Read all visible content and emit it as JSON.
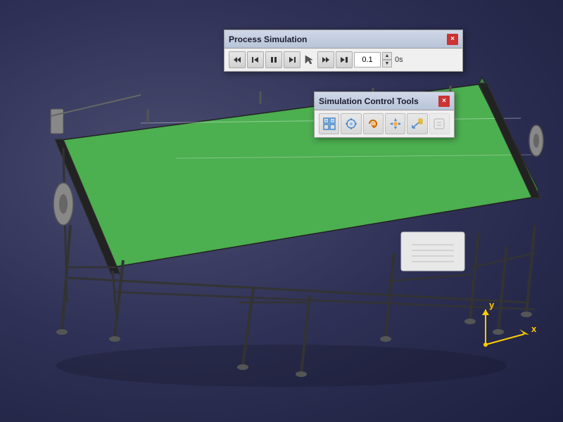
{
  "viewport": {
    "background_color": "#3d3f5e"
  },
  "process_simulation_dialog": {
    "title": "Process Simulation",
    "close_label": "×",
    "controls": {
      "rewind_label": "⏮",
      "step_back_label": "⏪",
      "pause_label": "⏸",
      "step_forward_label": "⏭",
      "fast_forward_label": "⏩",
      "end_label": "→"
    },
    "time_value": "0.1",
    "time_unit": "0s",
    "spinner_up": "▲",
    "spinner_down": "▼"
  },
  "simulation_control_tools_dialog": {
    "title": "Simulation Control Tools",
    "close_label": "×",
    "tools": [
      {
        "name": "grid-tool",
        "icon": "grid",
        "disabled": false
      },
      {
        "name": "snap-tool",
        "icon": "snap",
        "disabled": false
      },
      {
        "name": "rotate-tool",
        "icon": "rotate",
        "disabled": false
      },
      {
        "name": "move-tool",
        "icon": "move",
        "disabled": false
      },
      {
        "name": "measure-tool",
        "icon": "measure",
        "disabled": false
      },
      {
        "name": "extra-tool",
        "icon": "extra",
        "disabled": true
      }
    ]
  },
  "axis": {
    "x_label": "x",
    "y_label": "y",
    "color_x": "#ffcc00",
    "color_y": "#ffcc00"
  }
}
